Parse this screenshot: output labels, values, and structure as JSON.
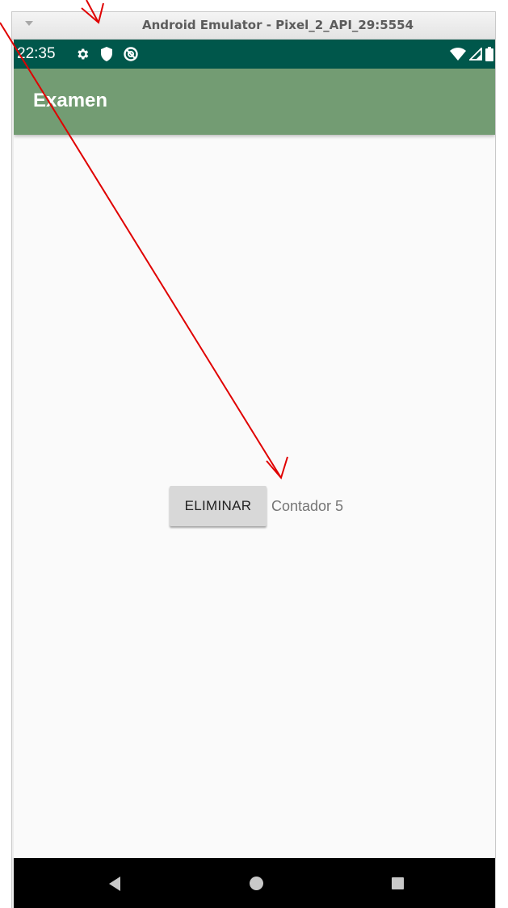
{
  "window": {
    "title": "Android Emulator - Pixel_2_API_29:5554"
  },
  "statusbar": {
    "time": "22:35",
    "left_icons": [
      "settings-gear-icon",
      "shield-icon",
      "do-not-disturb-icon"
    ],
    "right_icons": [
      "wifi-icon",
      "cell-signal-icon",
      "battery-icon"
    ]
  },
  "appbar": {
    "title": "Examen"
  },
  "main": {
    "delete_button_label": "ELIMINAR",
    "counter_text": "Contador 5"
  },
  "navbar": {
    "icons": [
      "back-icon",
      "home-icon",
      "recents-icon"
    ]
  },
  "colors": {
    "statusbar": "#00574b",
    "appbar": "#739c73",
    "annotation_arrow": "#e00000"
  }
}
